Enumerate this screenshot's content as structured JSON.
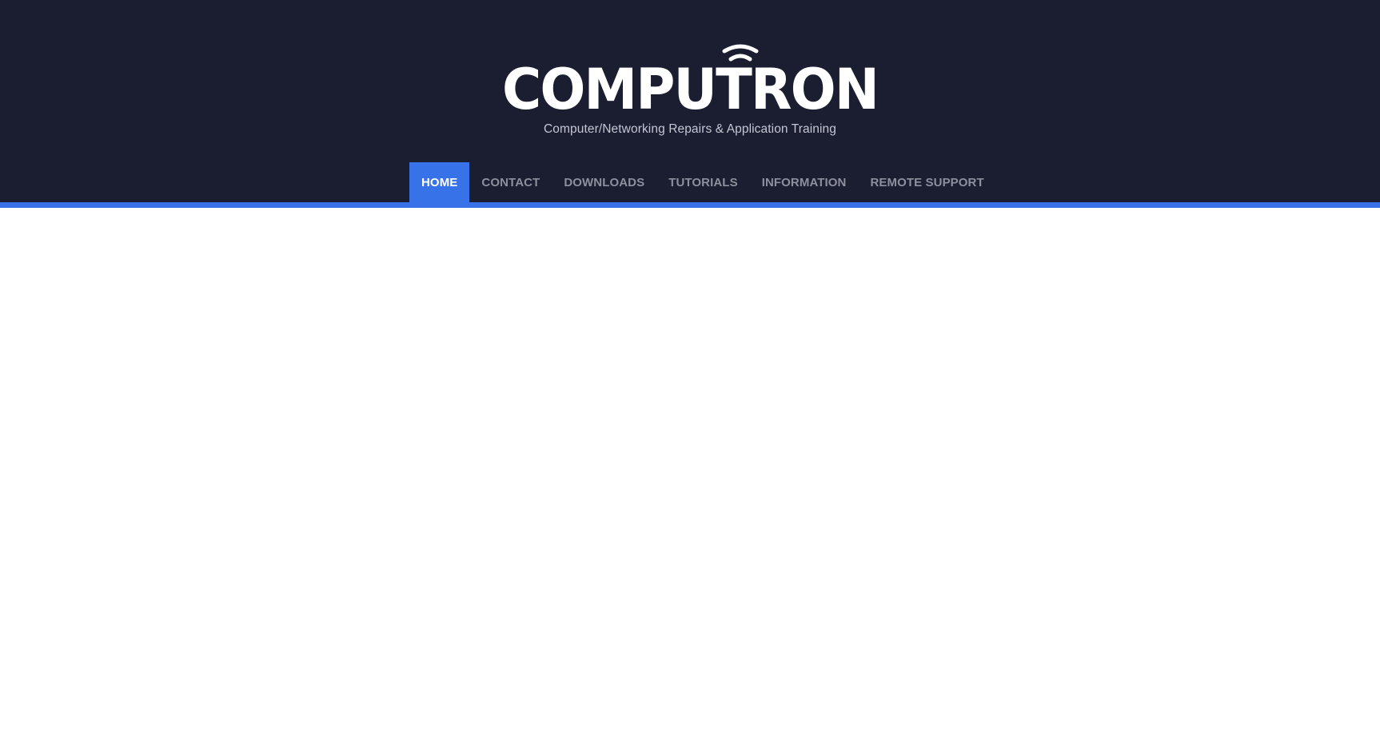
{
  "brand": {
    "logo_text": "COMPUTRON",
    "tagline": "Computer/Networking Repairs & Application Training"
  },
  "nav": {
    "items": [
      {
        "label": "HOME",
        "active": true
      },
      {
        "label": "CONTACT",
        "active": false
      },
      {
        "label": "DOWNLOADS",
        "active": false
      },
      {
        "label": "TUTORIALS",
        "active": false
      },
      {
        "label": "INFORMATION",
        "active": false
      },
      {
        "label": "REMOTE SUPPORT",
        "active": false
      }
    ]
  },
  "colors": {
    "header_bg": "#1b1e30",
    "accent": "#3872e8",
    "nav_text": "#8c8f9c",
    "tagline_text": "#c4c7d3",
    "page_bg": "#ffffff"
  },
  "icons": {
    "logo_signal": "wifi-signal-icon"
  }
}
